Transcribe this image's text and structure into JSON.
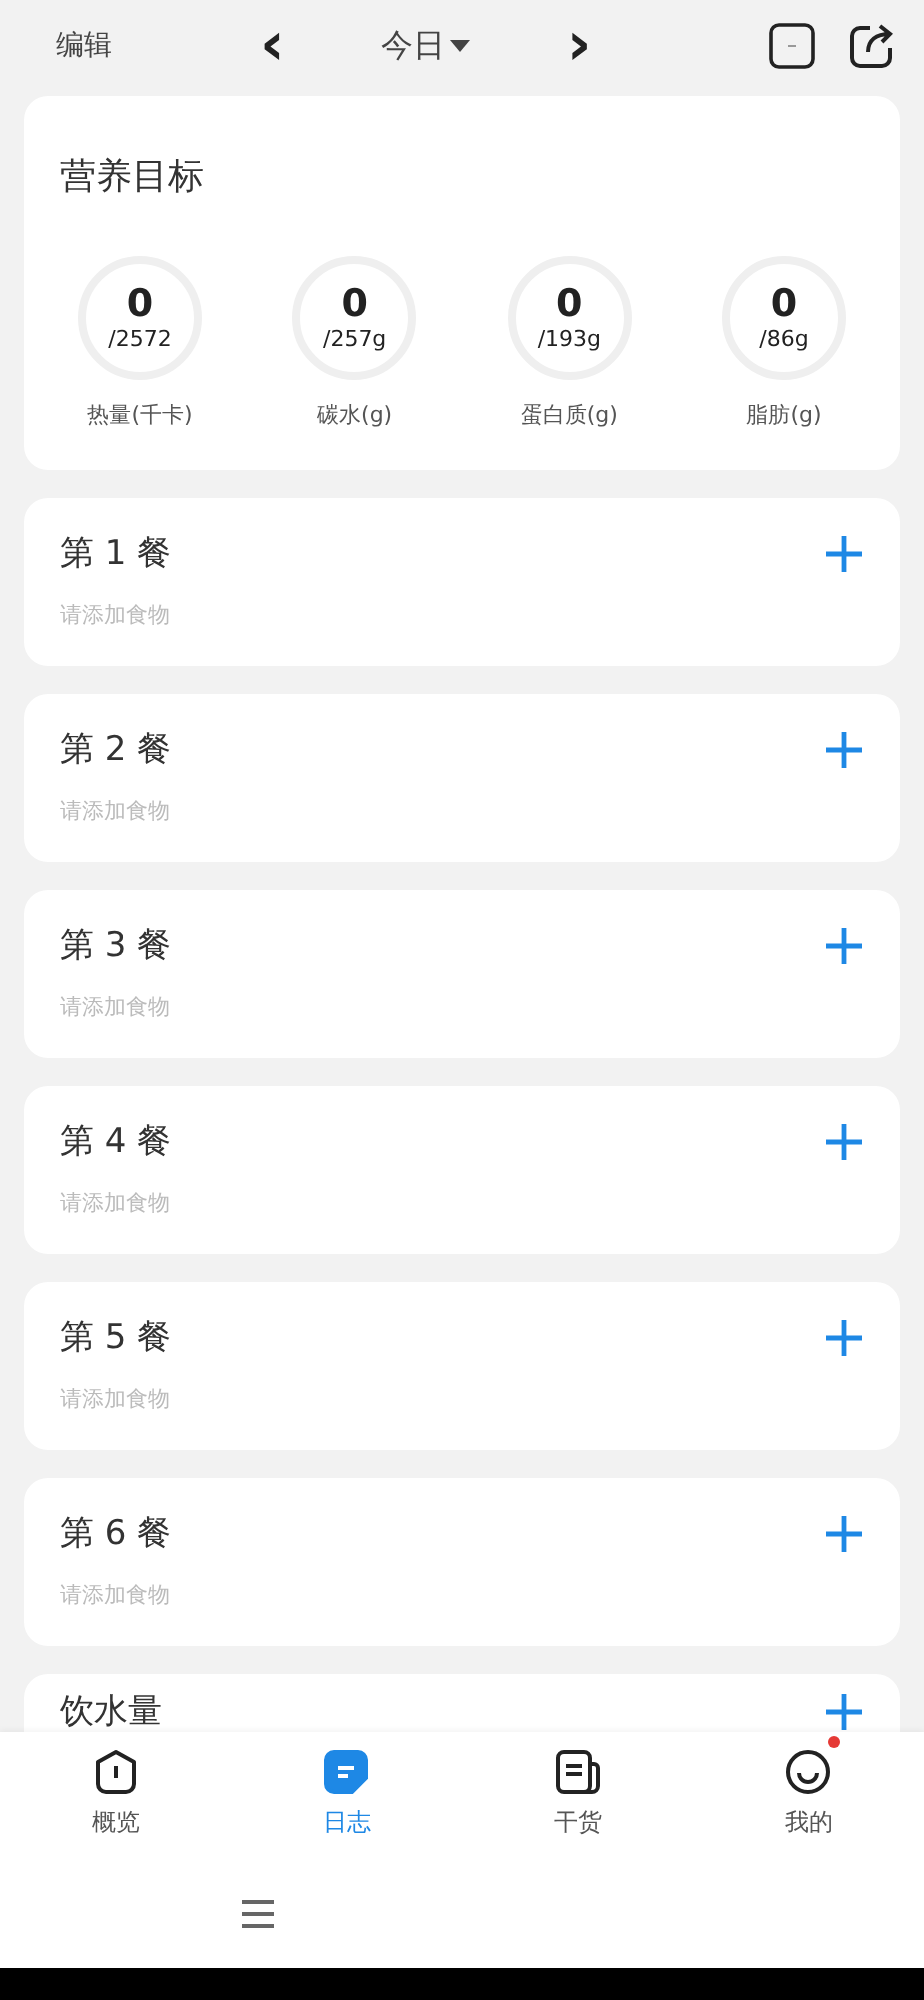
{
  "top_bar": {
    "edit": "编辑",
    "prev": "‹",
    "date": "今日",
    "next": "›"
  },
  "nutrition_goals": {
    "title": "营养目标",
    "items": [
      {
        "value": "0",
        "target": "/2572",
        "label": "热量(千卡)",
        "level": 0
      },
      {
        "value": "0",
        "target": "/257g",
        "label": "碳水(g)",
        "level": 0
      },
      {
        "value": "0",
        "target": "/193g",
        "label": "蛋白质(g)",
        "level": 0
      },
      {
        "value": "0",
        "target": "/86g",
        "label": "脂肪(g)",
        "level": 0
      }
    ]
  },
  "meals": [
    {
      "title": "第 1 餐",
      "hint": "请添加食物"
    },
    {
      "title": "第 2 餐",
      "hint": "请添加食物"
    },
    {
      "title": "第 3 餐",
      "hint": "请添加食物"
    },
    {
      "title": "第 4 餐",
      "hint": "请添加食物"
    },
    {
      "title": "第 5 餐",
      "hint": "请添加食物"
    },
    {
      "title": "第 6 餐",
      "hint": "请添加食物"
    },
    {
      "title": "饮水量"
    }
  ],
  "tab_bar": [
    {
      "label": "概览",
      "kind": "overview",
      "selected": false,
      "badge": false
    },
    {
      "label": "日志",
      "kind": "log",
      "selected": true,
      "badge": false
    },
    {
      "label": "干货",
      "kind": "articles",
      "selected": false,
      "badge": false
    },
    {
      "label": "我的",
      "kind": "profile",
      "selected": false,
      "badge": true
    }
  ]
}
